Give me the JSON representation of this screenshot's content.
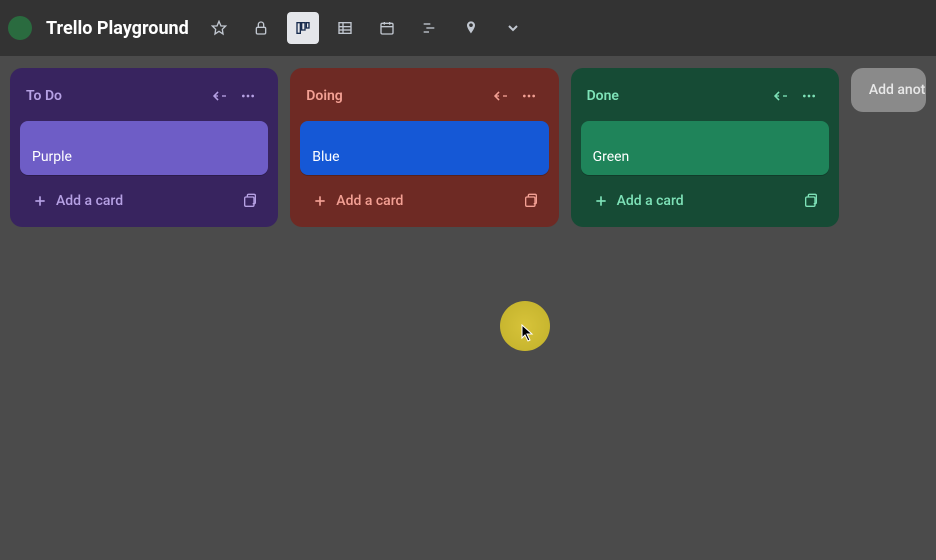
{
  "header": {
    "board_title": "Trello Playground"
  },
  "lists": [
    {
      "title": "To Do",
      "theme": "purple",
      "card": {
        "label": "Purple"
      },
      "add_label": "Add a card"
    },
    {
      "title": "Doing",
      "theme": "red",
      "card": {
        "label": "Blue"
      },
      "add_label": "Add a card"
    },
    {
      "title": "Done",
      "theme": "green",
      "card": {
        "label": "Green"
      },
      "add_label": "Add a card"
    }
  ],
  "add_list_label": "Add another list"
}
